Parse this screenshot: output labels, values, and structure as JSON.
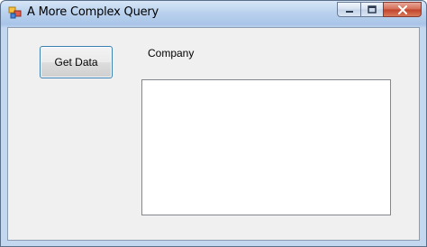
{
  "window": {
    "title": "A More Complex Query",
    "controls": {
      "minimize_icon": "minimize-icon",
      "maximize_icon": "maximize-icon",
      "close_icon": "close-icon"
    }
  },
  "form": {
    "get_data_button": "Get Data",
    "company_label": "Company",
    "company_list": {
      "items": []
    }
  },
  "colors": {
    "titlebar": "#bcd3ee",
    "client": "#f0f0f0",
    "button_border": "#3c7fb1",
    "close_button": "#c0412a"
  }
}
